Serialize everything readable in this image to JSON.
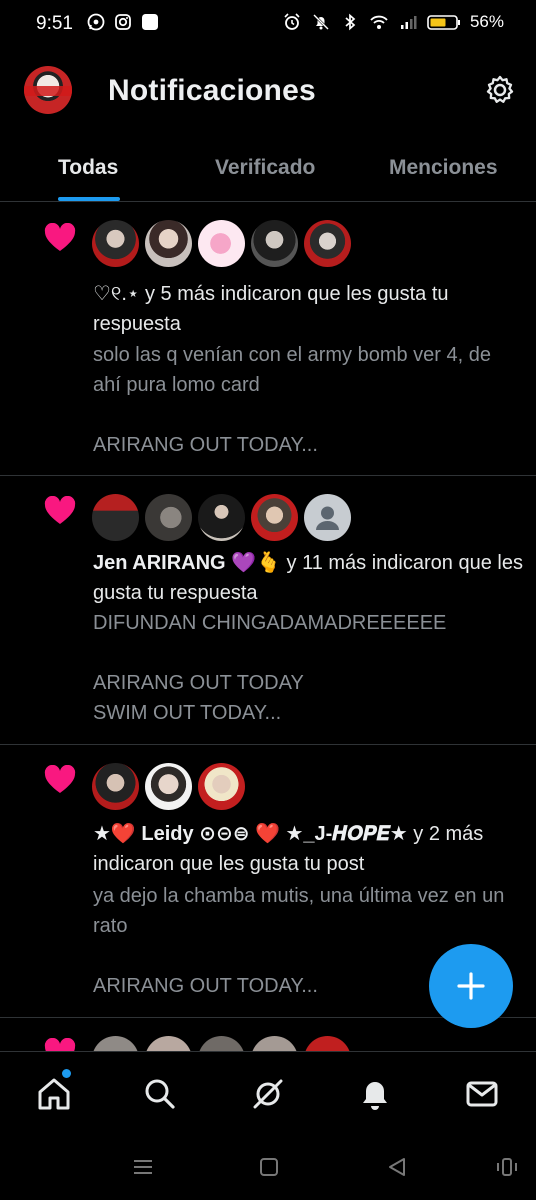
{
  "status_bar": {
    "time": "9:51",
    "battery": "56%"
  },
  "header": {
    "title": "Notificaciones"
  },
  "tabs": [
    {
      "label": "Todas",
      "active": true
    },
    {
      "label": "Verificado",
      "active": false
    },
    {
      "label": "Menciones",
      "active": false
    }
  ],
  "notifications": [
    {
      "type": "like",
      "avatar_count": 5,
      "actor": "♡୧.⋆",
      "action": " y 5 más indicaron que les gusta tu respuesta",
      "snippet": "solo las q venían con el army bomb ver 4, de ahí pura lomo card\n\nARIRANG OUT TODAY..."
    },
    {
      "type": "like",
      "avatar_count": 5,
      "actor": "Jen ARIRANG 💜🫰",
      "action": " y 11 más indicaron que les gusta tu respuesta",
      "snippet": "DIFUNDAN CHINGADAMADREEEEEE\n\nARIRANG OUT TODAY\nSWIM OUT TODAY..."
    },
    {
      "type": "like",
      "avatar_count": 3,
      "actor": "★❤️ Leidy ⊙⊝⊜ ❤️ ★_J-𝑯𝑶𝑷𝑬★",
      "action": " y 2 más indicaron que les gusta tu post",
      "snippet": "ya dejo la chamba mutis, una última vez en un rato\n\nARIRANG OUT TODAY..."
    }
  ],
  "colors": {
    "accent": "#1d9bf0",
    "heart": "#f91880",
    "background": "#000000",
    "muted_text": "#8b9096"
  },
  "icons": {
    "fab": "plus-icon",
    "nav": [
      "home-icon",
      "search-icon",
      "grok-icon",
      "notifications-bell-icon",
      "messages-mail-icon"
    ]
  }
}
